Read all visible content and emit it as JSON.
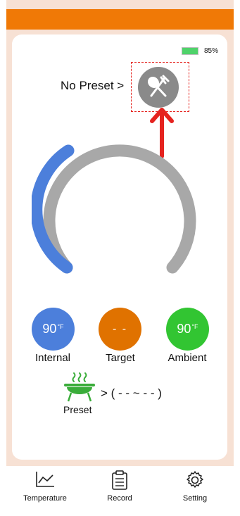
{
  "battery": {
    "percent_text": "85%",
    "level": 0.85,
    "color": "#4fd26a"
  },
  "preset_header": {
    "label": "No Preset >",
    "icon": "fork-spoon-icon"
  },
  "gauge": {
    "fill_fraction": 0.27,
    "fill_color": "#4c7fdb",
    "track_color": "#a8a8a8"
  },
  "readings": {
    "internal": {
      "value": "90",
      "unit": "°F",
      "label": "Internal",
      "color": "#4c7fdb"
    },
    "target": {
      "value": "- -",
      "label": "Target",
      "color": "#e07200"
    },
    "ambient": {
      "value": "90",
      "unit": "°F",
      "label": "Ambient",
      "color": "#32c532"
    }
  },
  "preset": {
    "range_text": "> ( - - ~ - - )",
    "label": "Preset",
    "icon": "grill-icon"
  },
  "nav": {
    "items": [
      {
        "label": "Temperature",
        "icon": "chart-line-icon"
      },
      {
        "label": "Record",
        "icon": "clipboard-icon"
      },
      {
        "label": "Setting",
        "icon": "gear-icon"
      }
    ]
  },
  "colors": {
    "topbar": "#f07906",
    "frame": "#f7e1d4",
    "highlight": "#e5231f"
  }
}
